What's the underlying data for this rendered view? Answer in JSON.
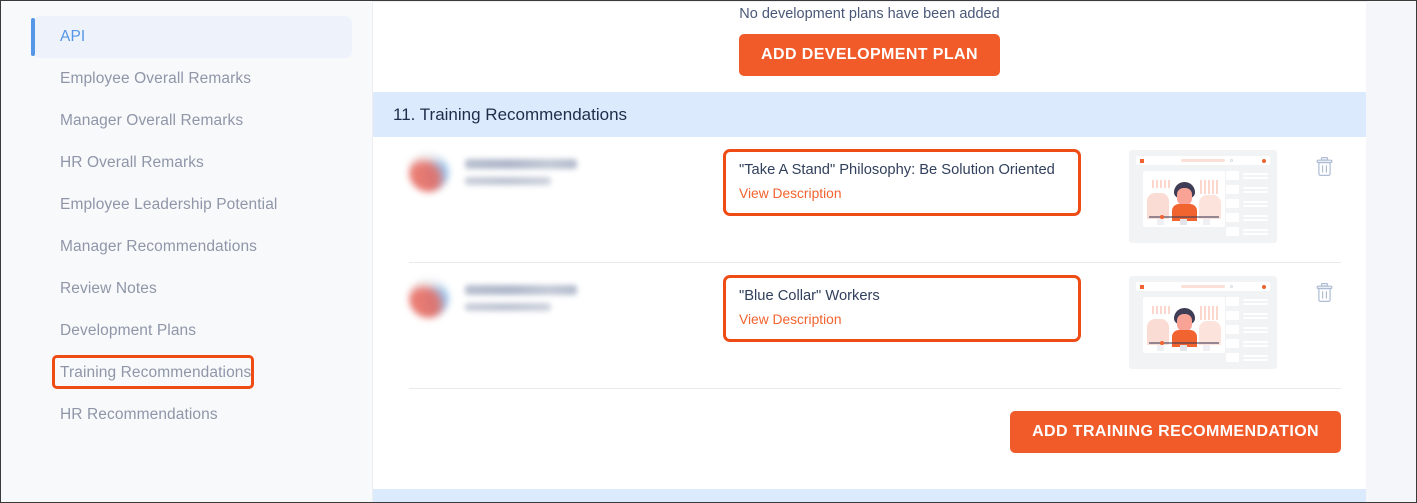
{
  "sidebar": {
    "items": [
      {
        "label": "API",
        "active": true
      },
      {
        "label": "Employee Overall Remarks",
        "active": false
      },
      {
        "label": "Manager Overall Remarks",
        "active": false
      },
      {
        "label": "HR Overall Remarks",
        "active": false
      },
      {
        "label": "Employee Leadership Potential",
        "active": false
      },
      {
        "label": "Manager Recommendations",
        "active": false
      },
      {
        "label": "Review Notes",
        "active": false
      },
      {
        "label": "Development Plans",
        "active": false
      },
      {
        "label": "Training Recommendations",
        "active": false,
        "highlighted": true
      },
      {
        "label": "HR Recommendations",
        "active": false
      }
    ]
  },
  "development_plans": {
    "empty_text": "No development plans have been added",
    "add_button_label": "ADD DEVELOPMENT PLAN"
  },
  "training_section": {
    "heading": "11. Training Recommendations",
    "rows": [
      {
        "title": "\"Take A Stand\" Philosophy: Be Solution Oriented",
        "view_description_label": "View Description",
        "delete_icon": "trash-icon",
        "thumbnail": "video-course-thumbnail"
      },
      {
        "title": "\"Blue Collar\" Workers",
        "view_description_label": "View Description",
        "delete_icon": "trash-icon",
        "thumbnail": "video-course-thumbnail"
      }
    ],
    "add_button_label": "ADD TRAINING RECOMMENDATION"
  },
  "colors": {
    "accent_orange": "#f15a29",
    "highlight_orange": "#ee4b15",
    "section_blue": "#dbeafc",
    "active_nav_blue": "#5596e6",
    "nav_text": "#8f96a8",
    "title_text": "#31405c"
  }
}
